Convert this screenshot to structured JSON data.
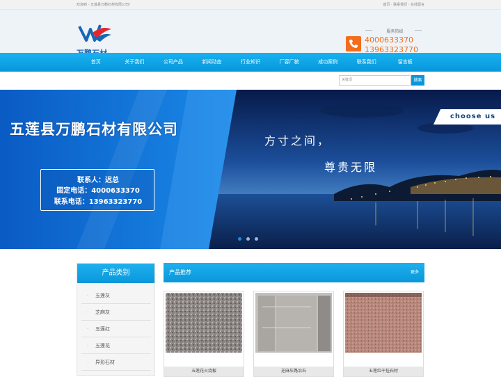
{
  "topbar": {
    "welcome": "欢迎到 - 五莲县万鹏石材有限公司！",
    "links": "首页 · 联系我们 · 在线留言"
  },
  "header": {
    "logo_text": "万鹏石材",
    "hotline_label": "服务热线",
    "phone1": "4000633370",
    "phone2": "13963323770"
  },
  "nav": {
    "items": [
      "首页",
      "关于我们",
      "公司产品",
      "新闻动态",
      "行业知识",
      "厂容厂貌",
      "成功案例",
      "联系我们",
      "留言板"
    ]
  },
  "search": {
    "placeholder": "关键词",
    "button": "搜索"
  },
  "banner": {
    "title": "五莲县万鹏石材有限公司",
    "slogan1": "方寸之间，",
    "slogan2": "尊贵无限",
    "contact_person": "联系人：迟总",
    "fixed_phone": "固定电话：4000633370",
    "mobile_phone": "联系电话：13963323770",
    "choose": "choose us"
  },
  "sidebar": {
    "title": "产品类别",
    "items": [
      "五莲灰",
      "芝麻灰",
      "五莲红",
      "五莲花",
      "异形石材"
    ]
  },
  "products": {
    "title": "产品推荐",
    "more": "更多",
    "items": [
      {
        "caption": "五莲花火烧板"
      },
      {
        "caption": "芝麻灰路沿石"
      },
      {
        "caption": "五莲红干挂石材"
      }
    ]
  },
  "colors": {
    "accent": "#0a96dc",
    "phone": "#f26d1c"
  }
}
